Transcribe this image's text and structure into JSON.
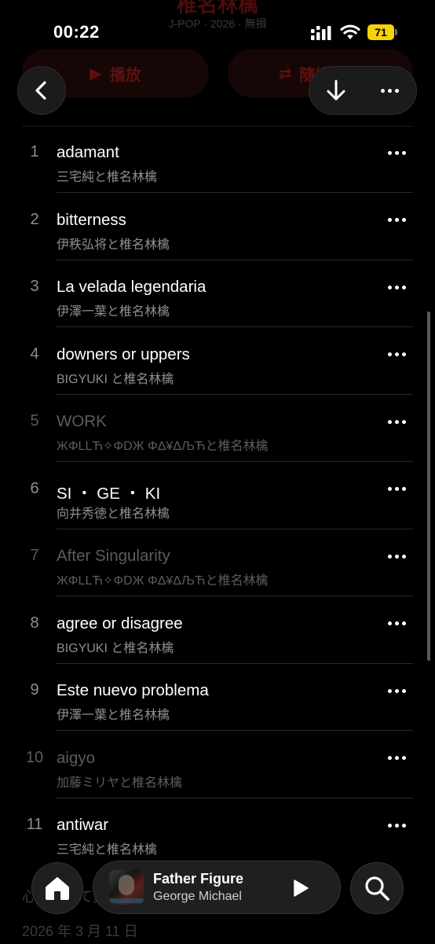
{
  "status_bar": {
    "time": "00:22",
    "battery": "71"
  },
  "album_header": {
    "title": "椎名林檎",
    "meta": "J-POP · 2026 · 無損",
    "play_label": "播放",
    "shuffle_label": "隨機播放"
  },
  "tracks": [
    {
      "num": "1",
      "title": "adamant",
      "artist": "三宅純と椎名林檎",
      "available": true
    },
    {
      "num": "2",
      "title": "bitterness",
      "artist": "伊秩弘将と椎名林檎",
      "available": true
    },
    {
      "num": "3",
      "title": "La velada legendaria",
      "artist": "伊澤一葉と椎名林檎",
      "available": true
    },
    {
      "num": "4",
      "title": "downers or uppers",
      "artist": "BIGYUKI と椎名林檎",
      "available": true
    },
    {
      "num": "5",
      "title": "WORK",
      "artist": "ЖΦLLЋ✧ΦDЖ ΦΔ¥ΔЉЋと椎名林檎",
      "available": false
    },
    {
      "num": "6",
      "title": "SI ・ GE ・ KI",
      "artist": "向井秀徳と椎名林檎",
      "available": true
    },
    {
      "num": "7",
      "title": "After Singularity",
      "artist": "ЖΦLLЋ✧ΦDЖ ΦΔ¥ΔЉЋと椎名林檎",
      "available": false
    },
    {
      "num": "8",
      "title": "agree or disagree",
      "artist": "BIGYUKI と椎名林檎",
      "available": true
    },
    {
      "num": "9",
      "title": "Este nuevo problema",
      "artist": "伊澤一葉と椎名林檎",
      "available": true
    },
    {
      "num": "10",
      "title": "aigyo",
      "artist": "加藤ミリヤと椎名林檎",
      "available": false
    },
    {
      "num": "11",
      "title": "antiwar",
      "artist": "三宅純と椎名林檎",
      "available": true
    }
  ],
  "footer": {
    "line1": "心を込めて愛を贈る",
    "line2": "2026 年 3 月 11 日"
  },
  "now_playing": {
    "title": "Father Figure",
    "artist": "George Michael"
  },
  "icons": {
    "back": "chevron-left-icon",
    "download": "arrow-down-icon",
    "more": "ellipsis-icon",
    "home": "house-icon",
    "play": "play-icon",
    "search": "magnifier-icon"
  },
  "colors": {
    "background": "#000000",
    "secondary_text": "#8e8e93",
    "battery": "#f5d20a",
    "header_accent": "#8a1414"
  }
}
